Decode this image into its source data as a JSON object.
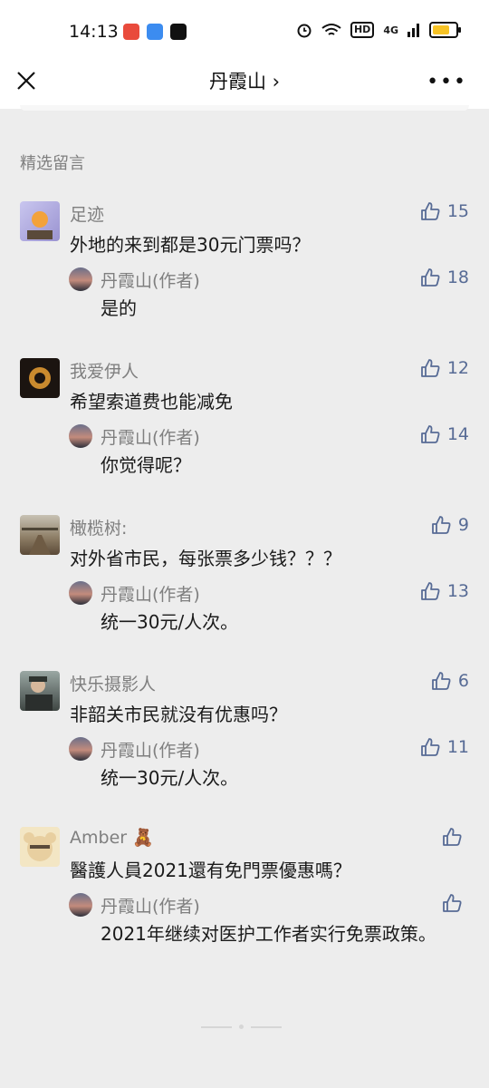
{
  "status_bar": {
    "time": "14:13",
    "network": "4G",
    "hd_label": "HD",
    "battery_color": "#f7c325"
  },
  "nav": {
    "title": "丹霞山",
    "chevron": "›",
    "more": "•••"
  },
  "section": {
    "label": "精选留言"
  },
  "comments": [
    {
      "name": "足迹",
      "text": "外地的来到都是30元门票吗？",
      "likes": "15",
      "reply": {
        "name": "丹霞山(作者)",
        "text": "是的",
        "likes": "18"
      }
    },
    {
      "name": "我爱伊人",
      "text": "希望索道费也能减免",
      "likes": "12",
      "reply": {
        "name": "丹霞山(作者)",
        "text": "你觉得呢？",
        "likes": "14"
      }
    },
    {
      "name": "橄榄树:",
      "text": "对外省市民，每张票多少钱？？？",
      "likes": "9",
      "reply": {
        "name": "丹霞山(作者)",
        "text": "统一30元/人次。",
        "likes": "13"
      }
    },
    {
      "name": "快乐摄影人",
      "text": "非韶关市民就没有优惠吗？",
      "likes": "6",
      "reply": {
        "name": "丹霞山(作者)",
        "text": "统一30元/人次。",
        "likes": "11"
      }
    },
    {
      "name": "Amber 🧸",
      "text": "醫護人員2021還有免門票優惠嗎？",
      "likes": "",
      "reply": {
        "name": "丹霞山(作者)",
        "text": "2021年继续对医护工作者实行免票政策。",
        "likes": ""
      }
    }
  ],
  "colors": {
    "link": "#576b95",
    "meta": "#7f7f7f",
    "background": "#ededed"
  }
}
